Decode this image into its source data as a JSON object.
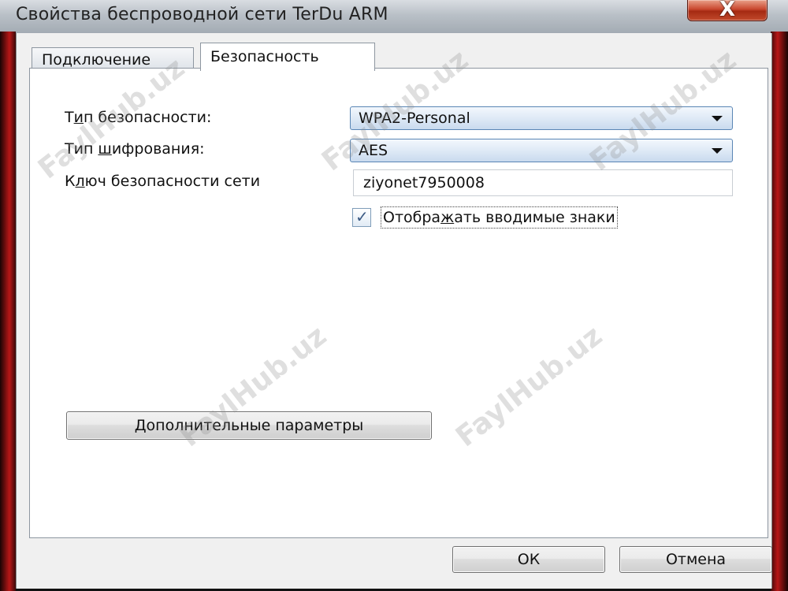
{
  "window": {
    "title": "Свойства беспроводной сети TerDu ARM",
    "close_glyph": "X"
  },
  "tabs": [
    {
      "label": "Подключение",
      "selected": false
    },
    {
      "label": "Безопасность",
      "selected": true
    }
  ],
  "security": {
    "type_label_pre": "Т",
    "type_label_acc": "и",
    "type_label_post": "п безопасности:",
    "type_value": "WPA2-Personal",
    "encryption_label_pre": "Тип ",
    "encryption_label_acc": "ш",
    "encryption_label_post": "ифрования:",
    "encryption_value": "AES",
    "key_label_pre": "К",
    "key_label_acc": "л",
    "key_label_post": "юч безопасности сети",
    "key_value": "ziyonet7950008",
    "show_chars_checked": true,
    "show_chars_pre": "Отобра",
    "show_chars_acc": "ж",
    "show_chars_post": "ать вводимые знаки",
    "advanced_pre": "",
    "advanced_acc": "Д",
    "advanced_post": "ополнительные параметры"
  },
  "footer": {
    "ok_label": "ОК",
    "cancel_label": "Отмена"
  },
  "watermark_text": "FaylHub.uz"
}
